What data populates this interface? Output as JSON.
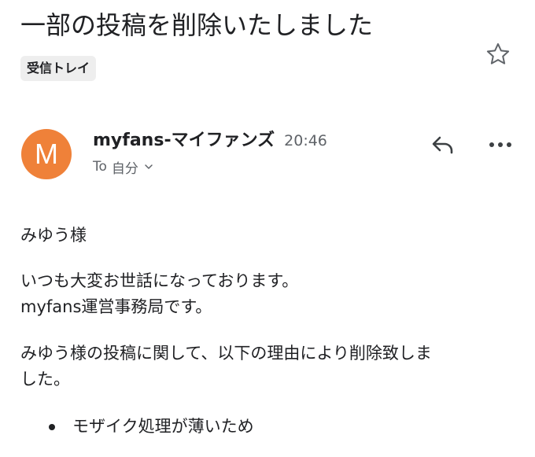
{
  "email": {
    "subject": "一部の投稿を削除いたしました",
    "label": "受信トレイ",
    "sender": {
      "avatar_initial": "M",
      "avatar_color": "#ef8139",
      "name": "myfans-マイファンズ",
      "time": "20:46"
    },
    "recipient": {
      "to_word": "To",
      "name": "自分"
    },
    "body": {
      "greeting": "みゆう様",
      "para1_line1": "いつも大変お世話になっております。",
      "para1_line2": "myfans運営事務局です。",
      "para2_line1": "みゆう様の投稿に関して、以下の理由により削除致しま",
      "para2_line2": "した。",
      "bullets": [
        "モザイク処理が薄いため"
      ]
    }
  },
  "icons": {
    "star": "star-outline-icon",
    "reply": "reply-icon",
    "more": "more-horizontal-icon",
    "chevron": "chevron-down-icon"
  }
}
